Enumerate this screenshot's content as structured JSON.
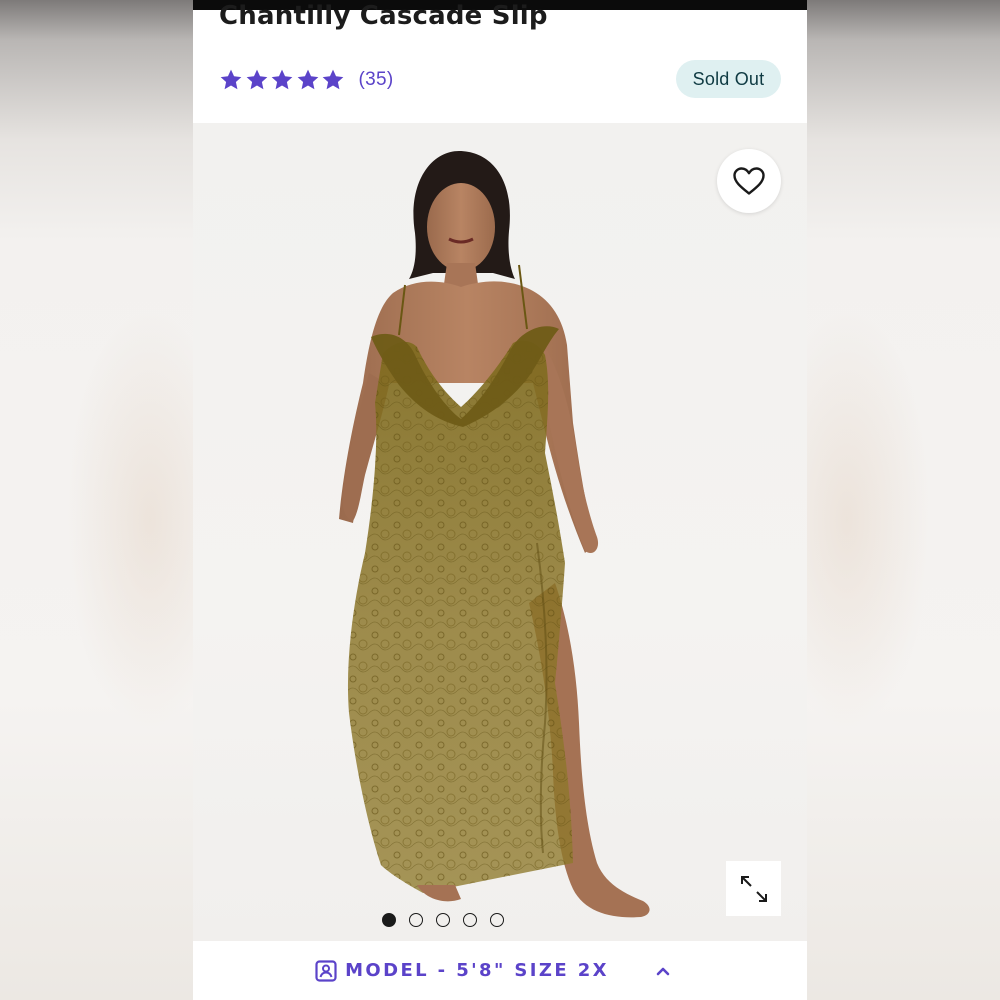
{
  "product": {
    "title": "Chantilly Cascade Slip",
    "review_count": "(35)",
    "stock_badge": "Sold Out",
    "rating": {
      "stars_filled": 5,
      "stars_total": 5
    }
  },
  "gallery": {
    "image_count": 5,
    "active_index": 0,
    "wishlist_icon": "heart-outline-icon",
    "expand_icon": "expand-arrows-icon"
  },
  "model_info": {
    "label": "MODEL - 5'8\" SIZE 2X",
    "icon": "person-badge-icon",
    "toggle_icon": "chevron-up-icon"
  },
  "colors": {
    "accent": "#5b43c9",
    "badge_bg": "#dff0f1",
    "badge_text": "#0f3b43",
    "title_text": "#1c1c1c"
  }
}
